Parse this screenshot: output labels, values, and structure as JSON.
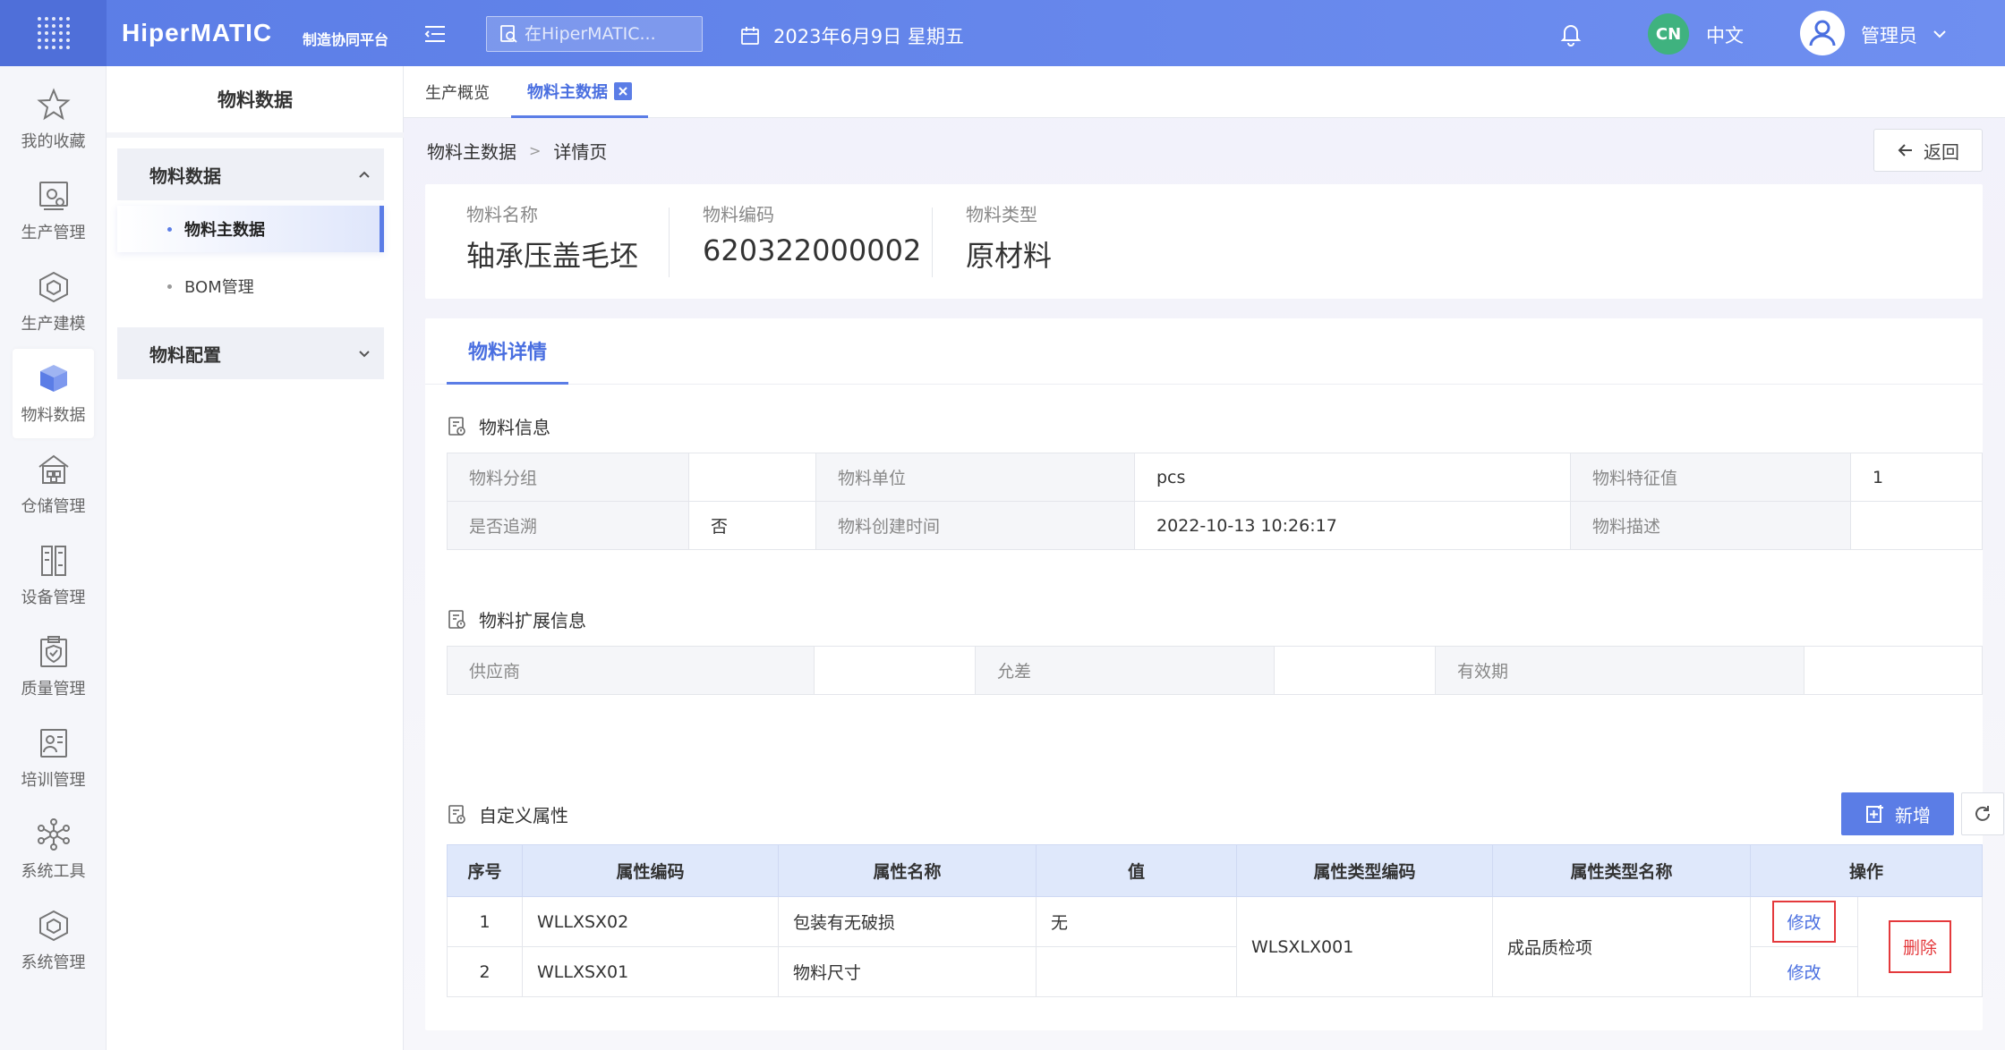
{
  "topbar": {
    "brand": "HiperMATIC",
    "brand_sub": "制造协同平台",
    "search_placeholder": "在HiperMATIC...",
    "date": "2023年6月9日 星期五",
    "lang_badge": "CN",
    "lang": "中文",
    "user": "管理员"
  },
  "rail": [
    {
      "label": "我的收藏",
      "icon": "star-icon"
    },
    {
      "label": "生产管理",
      "icon": "production-icon"
    },
    {
      "label": "生产建模",
      "icon": "modeling-cube-icon"
    },
    {
      "label": "物料数据",
      "icon": "material-box-icon"
    },
    {
      "label": "仓储管理",
      "icon": "warehouse-icon"
    },
    {
      "label": "设备管理",
      "icon": "device-icon"
    },
    {
      "label": "质量管理",
      "icon": "quality-shield-icon"
    },
    {
      "label": "培训管理",
      "icon": "training-icon"
    },
    {
      "label": "系统工具",
      "icon": "network-icon"
    },
    {
      "label": "系统管理",
      "icon": "system-cube-icon"
    }
  ],
  "subnav": {
    "title": "物料数据",
    "group1": "物料数据",
    "items": [
      "物料主数据",
      "BOM管理"
    ],
    "group2": "物料配置"
  },
  "tabs": [
    "生产概览",
    "物料主数据"
  ],
  "crumb": {
    "parent": "物料主数据",
    "sep": ">",
    "current": "详情页"
  },
  "back": "返回",
  "summary": [
    {
      "label": "物料名称",
      "value": "轴承压盖毛坯"
    },
    {
      "label": "物料编码",
      "value": "620322000002"
    },
    {
      "label": "物料类型",
      "value": "原材料"
    }
  ],
  "detail_tab": "物料详情",
  "info": {
    "title": "物料信息",
    "rows": [
      [
        "物料分组",
        "",
        "物料单位",
        "pcs",
        "物料特征值",
        "1"
      ],
      [
        "是否追溯",
        "否",
        "物料创建时间",
        "2022-10-13 10:26:17",
        "物料描述",
        ""
      ]
    ]
  },
  "ext": {
    "title": "物料扩展信息",
    "row": [
      "供应商",
      "",
      "允差",
      "",
      "有效期",
      ""
    ]
  },
  "custom": {
    "title": "自定义属性",
    "add": "新增",
    "headers": [
      "序号",
      "属性编码",
      "属性名称",
      "值",
      "属性类型编码",
      "属性类型名称",
      "操作"
    ],
    "rows": [
      {
        "no": "1",
        "code": "WLLXSX02",
        "name": "包装有无破损",
        "value": "无"
      },
      {
        "no": "2",
        "code": "WLLXSX01",
        "name": "物料尺寸",
        "value": ""
      }
    ],
    "type_code": "WLSXLX001",
    "type_name": "成品质检项",
    "edit": "修改",
    "delete": "删除"
  },
  "colors": {
    "primary": "#5b7de6",
    "danger": "#e4393c",
    "badge": "#3fb27f"
  }
}
